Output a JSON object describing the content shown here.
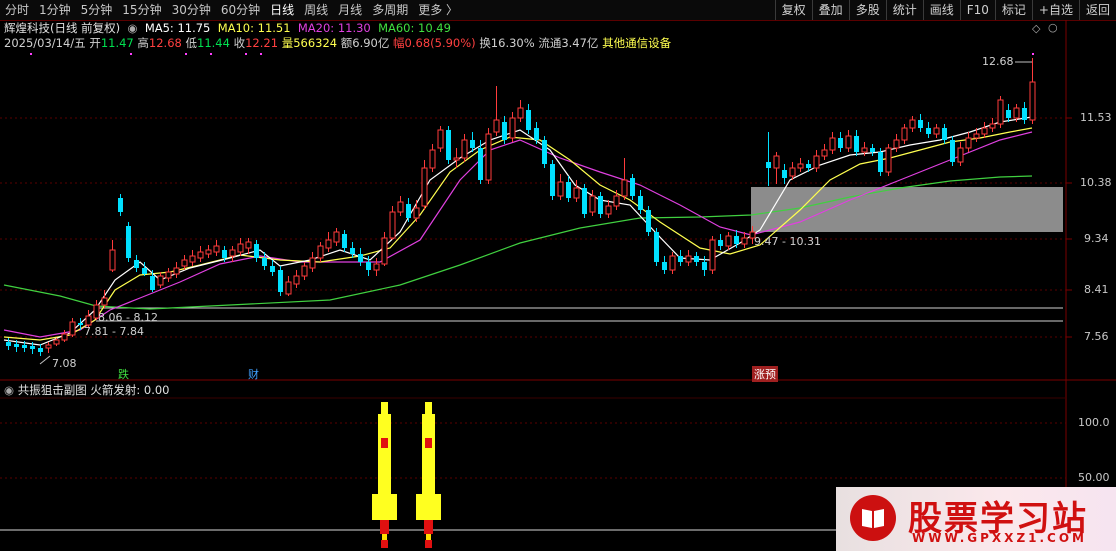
{
  "toolbar": {
    "items": [
      "分时",
      "1分钟",
      "5分钟",
      "15分钟",
      "30分钟",
      "60分钟",
      "日线",
      "周线",
      "月线",
      "多周期",
      "更多 〉"
    ],
    "right_buttons": [
      "复权",
      "叠加",
      "多股",
      "统计",
      "画线",
      "F10",
      "标记",
      "+自选",
      "返回"
    ]
  },
  "stock": {
    "name": "辉煌科技(日线 前复权)",
    "ma5": "MA5: 11.75",
    "ma10": "MA10: 11.51",
    "ma20": "MA20: 11.30",
    "ma60": "MA60: 10.49",
    "date": "2025/03/14/五",
    "open_label": "开",
    "open": "11.47",
    "high_label": "高",
    "high": "12.68",
    "low_label": "低",
    "low": "11.44",
    "close_label": "收",
    "close": "12.21",
    "volume": "量566324",
    "amount": "额6.90亿",
    "change": "幅0.68(5.90%)",
    "turnover": "换16.30%",
    "float": "流通3.47亿",
    "sector": "其他通信设备"
  },
  "price_axis": [
    "11.53",
    "10.38",
    "9.34",
    "8.41",
    "7.56"
  ],
  "annotations": {
    "peak": "12.68",
    "low_mark": "7.08",
    "zone1": "8.06 - 8.12",
    "zone2": "7.81 - 7.84",
    "zone3": "9.47 - 10.31",
    "tag_die": "跌",
    "tag_cai": "财",
    "tag_zhang": "涨预"
  },
  "indicator": {
    "title": "共振狙击副图",
    "value_label": "火箭发射: 0.00",
    "axis": [
      "100.0",
      "50.00"
    ]
  },
  "colors": {
    "up": "#ff3c3c",
    "down": "#00e0ff",
    "ma5": "#ffffff",
    "ma10": "#ffff50",
    "ma20": "#e040e0",
    "ma60": "#40e040"
  },
  "watermark": {
    "text": "股票学习站",
    "url": "WWW.GPXXZ1.COM"
  }
}
